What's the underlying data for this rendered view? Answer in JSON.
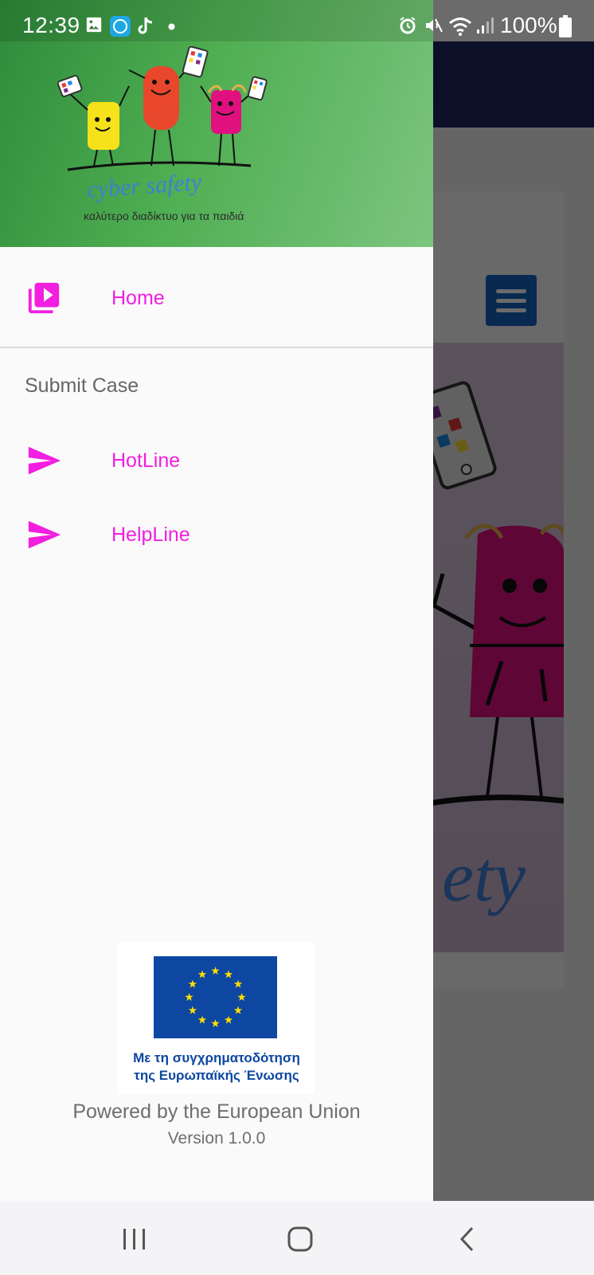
{
  "status_bar": {
    "time": "12:39",
    "battery_percent": "100%",
    "icons": [
      "gallery-icon",
      "box-app-icon",
      "tiktok-icon",
      "dot-icon",
      "alarm-icon",
      "mute-icon",
      "wifi-icon",
      "signal-icon",
      "battery-icon"
    ]
  },
  "drawer": {
    "logo": {
      "title": "cyber safety",
      "tagline": "καλύτερο διαδίκτυο για τα παιδιά"
    },
    "items": [
      {
        "label": "Home",
        "icon": "video-library-icon"
      }
    ],
    "section_title": "Submit Case",
    "submit_items": [
      {
        "label": "HotLine",
        "icon": "send-icon"
      },
      {
        "label": "HelpLine",
        "icon": "send-icon"
      }
    ],
    "footer": {
      "eu_caption_line1": "Με τη συγχρηματοδότηση",
      "eu_caption_line2": "της Ευρωπαϊκής Ένωσης",
      "powered": "Powered by the European Union",
      "version": "Version 1.0.0"
    }
  },
  "colors": {
    "accent": "#f21ee0",
    "header_green": "#4fae52",
    "app_bar": "#1e2461",
    "eu_blue": "#0d47a1"
  },
  "nav_bar": {
    "buttons": [
      "recents-button",
      "home-button",
      "back-button"
    ]
  }
}
